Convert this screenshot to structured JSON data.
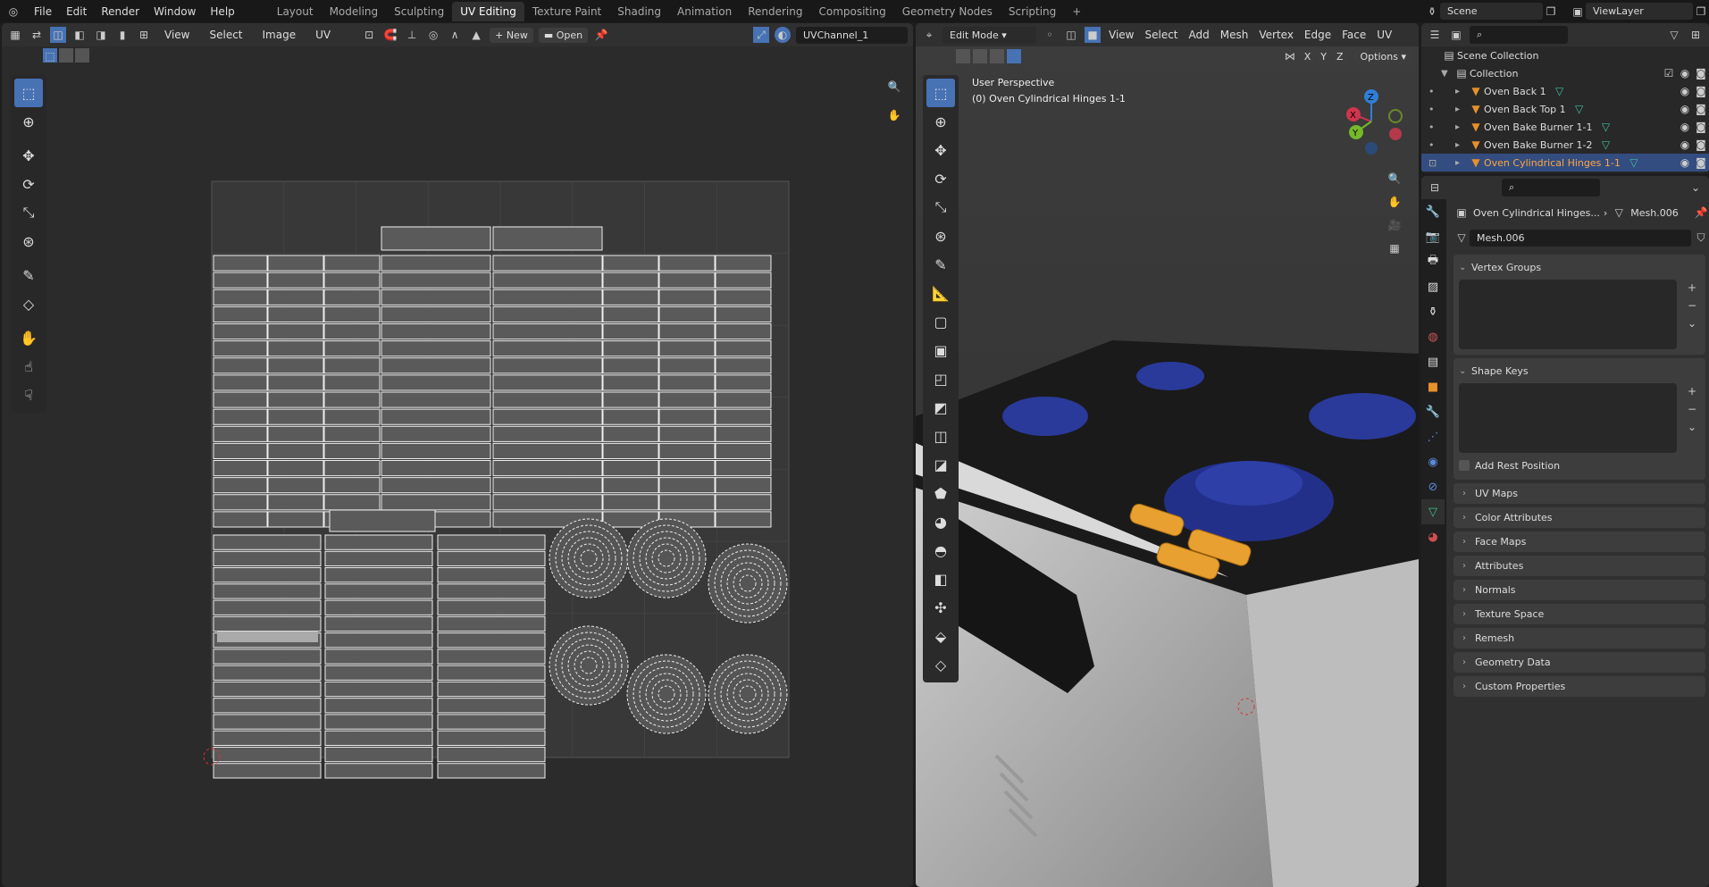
{
  "topbar": {
    "menus": [
      "File",
      "Edit",
      "Render",
      "Window",
      "Help"
    ],
    "workspaces": [
      "Layout",
      "Modeling",
      "Sculpting",
      "UV Editing",
      "Texture Paint",
      "Shading",
      "Animation",
      "Rendering",
      "Compositing",
      "Geometry Nodes",
      "Scripting"
    ],
    "active_workspace": "UV Editing",
    "add_label": "+",
    "scene": "Scene",
    "view_layer": "ViewLayer"
  },
  "uv_editor": {
    "menus": [
      "View",
      "Select",
      "Image",
      "UV"
    ],
    "new_label": "New",
    "open_label": "Open",
    "uv_channel": "UVChannel_1"
  },
  "viewport": {
    "mode": "Edit Mode",
    "menus": [
      "View",
      "Select",
      "Add",
      "Mesh",
      "Vertex",
      "Edge",
      "Face",
      "UV"
    ],
    "axes": [
      "X",
      "Y",
      "Z"
    ],
    "options_label": "Options",
    "overlay_title": "User Perspective",
    "overlay_object": "(0) Oven Cylindrical Hinges 1-1",
    "gizmo": {
      "x": "X",
      "y": "Y",
      "z": "Z"
    }
  },
  "outliner": {
    "scene_collection": "Scene Collection",
    "collection": "Collection",
    "items": [
      {
        "name": "Oven Back 1"
      },
      {
        "name": "Oven Back Top 1"
      },
      {
        "name": "Oven Bake Burner 1-1"
      },
      {
        "name": "Oven Bake Burner 1-2"
      },
      {
        "name": "Oven Cylindrical Hinges 1-1",
        "selected": true
      }
    ]
  },
  "properties": {
    "breadcrumb_object": "Oven Cylindrical Hinges...",
    "breadcrumb_mesh": "Mesh.006",
    "mesh_name": "Mesh.006",
    "vertex_groups": "Vertex Groups",
    "shape_keys": "Shape Keys",
    "add_rest_position": "Add Rest Position",
    "panels": [
      "UV Maps",
      "Color Attributes",
      "Face Maps",
      "Attributes",
      "Normals",
      "Texture Space",
      "Remesh",
      "Geometry Data",
      "Custom Properties"
    ]
  },
  "colors": {
    "accent": "#4772b3",
    "selected_text": "#ffa640",
    "burner": "#2a3a9a",
    "hinge": "#e8a030"
  }
}
